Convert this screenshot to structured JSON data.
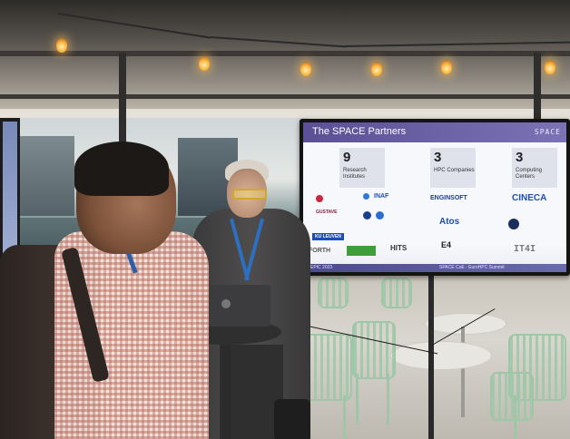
{
  "scene": {
    "description_tags": [
      "conference-booth",
      "display-screen",
      "two-people",
      "laptop"
    ]
  },
  "slide": {
    "title": "The SPACE Partners",
    "brand": "SPACE",
    "stats": [
      {
        "number": "9",
        "label": "Research Institutes"
      },
      {
        "number": "3",
        "label": "HPC Companies"
      },
      {
        "number": "3",
        "label": "Computing Centers"
      }
    ],
    "logos": [
      {
        "text": "ENGINSOFT",
        "color": "#1b3f8f"
      },
      {
        "text": "CINECA",
        "color": "#1d4fb3"
      },
      {
        "text": "Atos",
        "color": "#1d4fb3"
      },
      {
        "text": "KU LEUVEN",
        "color": "#ffffff"
      },
      {
        "text": "INAF",
        "color": "#1d4fb3"
      },
      {
        "text": "HITS",
        "color": "#333333"
      },
      {
        "text": "E4",
        "color": "#222222"
      },
      {
        "text": "IT4I",
        "color": "#7a7a7a"
      },
      {
        "text": "FORTH",
        "color": "#555555"
      }
    ],
    "footer_left": "EPIC 2023",
    "footer_right": "SPACE CoE · EuroHPC Summit"
  },
  "colors": {
    "slide_header": "#5b4f95",
    "bulb_glow": "#ffb640",
    "chairs": "#9fc6a6"
  }
}
